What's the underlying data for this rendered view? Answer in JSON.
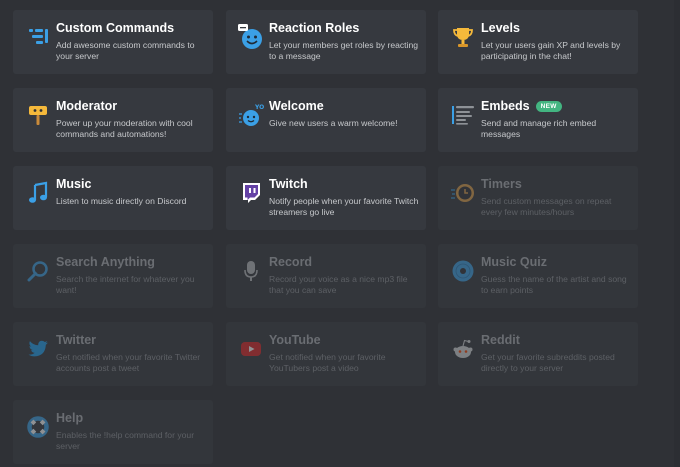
{
  "modules": [
    {
      "title": "Custom Commands",
      "description": "Add awesome custom commands to your server",
      "icon": "custom-commands-icon",
      "enabled": true
    },
    {
      "title": "Reaction Roles",
      "description": "Let your members get roles by reacting to a message",
      "icon": "reaction-roles-icon",
      "enabled": true
    },
    {
      "title": "Levels",
      "description": "Let your users gain XP and levels by participating in the chat!",
      "icon": "trophy-icon",
      "enabled": true
    },
    {
      "title": "Moderator",
      "description": "Power up your moderation with cool commands and automations!",
      "icon": "moderator-hammer-icon",
      "enabled": true
    },
    {
      "title": "Welcome",
      "description": "Give new users a warm welcome!",
      "icon": "welcome-chat-icon",
      "enabled": true
    },
    {
      "title": "Embeds",
      "badge": "NEW",
      "description": "Send and manage rich embed messages",
      "icon": "embed-message-icon",
      "enabled": true
    },
    {
      "title": "Music",
      "description": "Listen to music directly on Discord",
      "icon": "music-note-icon",
      "enabled": true
    },
    {
      "title": "Twitch",
      "description": "Notify people when your favorite Twitch streamers go live",
      "icon": "twitch-icon",
      "enabled": true
    },
    {
      "title": "Timers",
      "description": "Send custom messages on repeat every few minutes/hours",
      "icon": "timer-icon",
      "enabled": false
    },
    {
      "title": "Search Anything",
      "description": "Search the internet for whatever you want!",
      "icon": "search-icon",
      "enabled": false
    },
    {
      "title": "Record",
      "description": "Record your voice as a nice mp3 file that you can save",
      "icon": "microphone-icon",
      "enabled": false
    },
    {
      "title": "Music Quiz",
      "description": "Guess the name of the artist and song to earn points",
      "icon": "vinyl-disc-icon",
      "enabled": false
    },
    {
      "title": "Twitter",
      "description": "Get notified when your favorite Twitter accounts post a tweet",
      "icon": "twitter-bird-icon",
      "enabled": false
    },
    {
      "title": "YouTube",
      "description": "Get notified when your favorite YouTubers post a video",
      "icon": "youtube-icon",
      "enabled": false
    },
    {
      "title": "Reddit",
      "description": "Get your favorite subreddits posted directly to your server",
      "icon": "reddit-icon",
      "enabled": false
    },
    {
      "title": "Help",
      "description": "Enables the !help command for your server",
      "icon": "help-lifebuoy-icon",
      "enabled": false
    }
  ],
  "colors": {
    "background": "#2f3136",
    "card": "#36393f",
    "badge": "#43b581",
    "accent_blue": "#3ba0e6"
  }
}
